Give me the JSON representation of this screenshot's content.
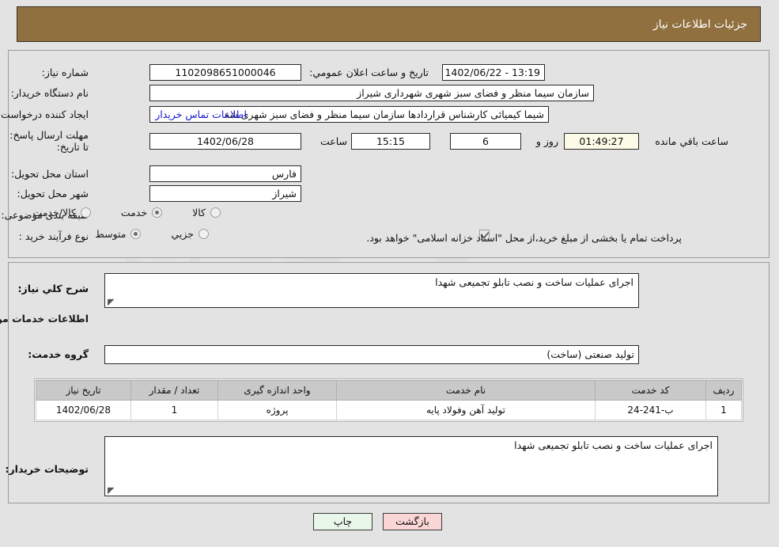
{
  "header": {
    "title": "جزئیات اطلاعات نیاز",
    "bg": "#90703f"
  },
  "form": {
    "need_number_label": "شماره نیاز:",
    "need_number_value": "1102098651000046",
    "announce_label": "تاریخ و ساعت اعلان عمومي:",
    "announce_value": "13:19 - 1402/06/22",
    "buyer_org_label": "نام دستگاه خریدار:",
    "buyer_org_value": "سازمان سیما منظر و فضای سبز شهری شهرداری شیراز",
    "requester_label": "ایجاد کننده درخواست:",
    "requester_value": "شیما کیمیائی کارشناس قراردادها سازمان سیما منظر و فضای سبز شهری شه",
    "contact_link": "اطلاعات تماس خریدار",
    "deadline_label": "مهلت ارسال پاسخ: تا تاریخ:",
    "deadline_date": "1402/06/28",
    "deadline_time_label": "ساعت",
    "deadline_time": "15:15",
    "days_remaining": "6",
    "days_label": "روز و",
    "hours_remaining": "01:49:27",
    "remaining_label": "ساعت باقي مانده",
    "province_label": "استان محل تحویل:",
    "province_value": "فارس",
    "city_label": "شهر محل تحویل:",
    "city_value": "شیراز",
    "category_label": "طبقه بندی موضوعی:",
    "category_options": [
      {
        "label": "کالا",
        "selected": false
      },
      {
        "label": "خدمت",
        "selected": true
      },
      {
        "label": "کالا/خدمت",
        "selected": false
      }
    ],
    "process_label": "نوع فرآیند خرید :",
    "process_options": [
      {
        "label": "جزيي",
        "selected": false
      },
      {
        "label": "متوسط",
        "selected": true
      }
    ],
    "treasury_checked": true,
    "treasury_text": "پرداخت تمام یا بخشی از مبلغ خرید،از محل \"اسناد خزانه اسلامی\" خواهد بود."
  },
  "middle": {
    "general_desc_label": "شرح کلي نیاز:",
    "general_desc_value": "اجرای عملیات ساخت و نصب تابلو تجمیعی شهدا",
    "services_section_title": "اطلاعات خدمات مورد نیاز",
    "service_group_label": "گروه خدمت:",
    "service_group_value": "تولید صنعتی (ساخت)",
    "buyer_notes_label": "توضیحات خریدار:",
    "buyer_notes_value": "اجرای عملیات ساخت و نصب تابلو تجمیعی شهدا"
  },
  "table": {
    "headers": [
      "ردیف",
      "کد خدمت",
      "نام خدمت",
      "واحد اندازه گیری",
      "تعداد / مقدار",
      "تاریخ نیاز"
    ],
    "rows": [
      [
        "1",
        "ب-241-24",
        "تولید آهن وفولاد پایه",
        "پروژه",
        "1",
        "1402/06/28"
      ]
    ]
  },
  "buttons": {
    "print": "چاپ",
    "back": "بازگشت"
  },
  "watermark": {
    "text": "AriaTender.net"
  }
}
